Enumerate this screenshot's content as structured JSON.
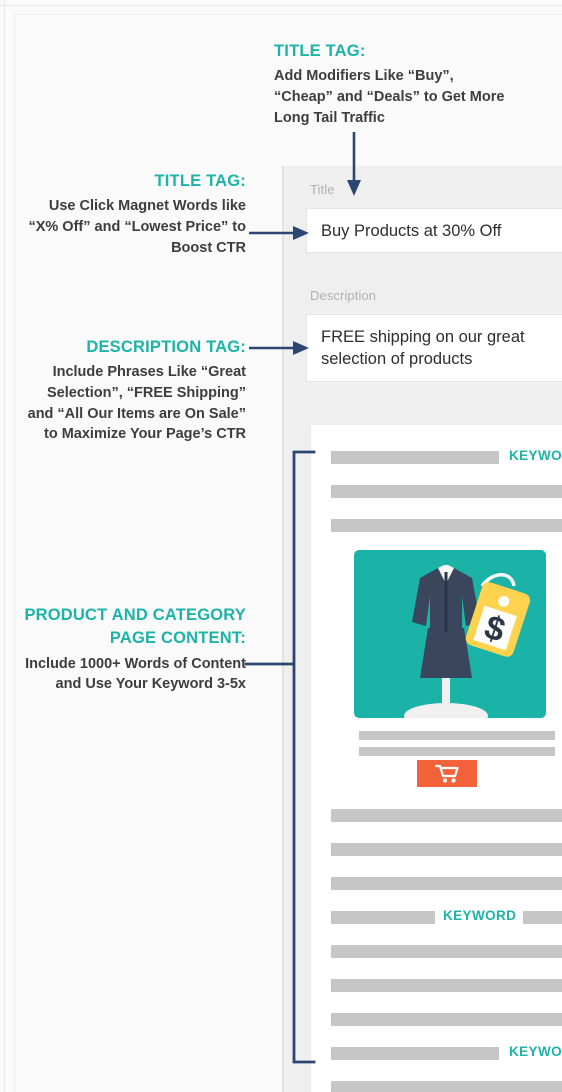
{
  "theme": {
    "accent_teal": "#1cb3a8",
    "arrow_navy": "#2b4672",
    "panel_gray": "#efefef",
    "bar_gray": "#c6c6c6",
    "cart_orange": "#f4623a",
    "page_bg": "#fafafa"
  },
  "callouts": {
    "title_tag_top": {
      "heading": "TITLE TAG:",
      "body": "Add Modifiers Like “Buy”, “Cheap” and “Deals” to Get More Long Tail Traffic"
    },
    "title_tag_left": {
      "heading": "TITLE TAG:",
      "body": "Use Click Magnet Words like “X% Off” and “Lowest Price” to Boost CTR"
    },
    "description_tag": {
      "heading": "DESCRIPTION TAG:",
      "body": "Include Phrases Like “Great Selection”, “FREE Shipping” and “All Our Items are On Sale” to Maximize Your Page’s CTR"
    },
    "page_content": {
      "heading": "PRODUCT AND CATEGORY PAGE CONTENT:",
      "body": "Include 1000+ Words of Content and Use Your Keyword 3-5x"
    }
  },
  "form": {
    "title_label": "Title",
    "title_value": "Buy Products at 30% Off",
    "description_label": "Description",
    "description_value": "FREE shipping on our great selection of products"
  },
  "content_card": {
    "keyword_label": "KEYWORD",
    "keyword_occurrences": 3,
    "cart_button_icon": "shopping-cart-icon",
    "product_image_alt": "teal-product-photo-dress-with-price-tag"
  }
}
